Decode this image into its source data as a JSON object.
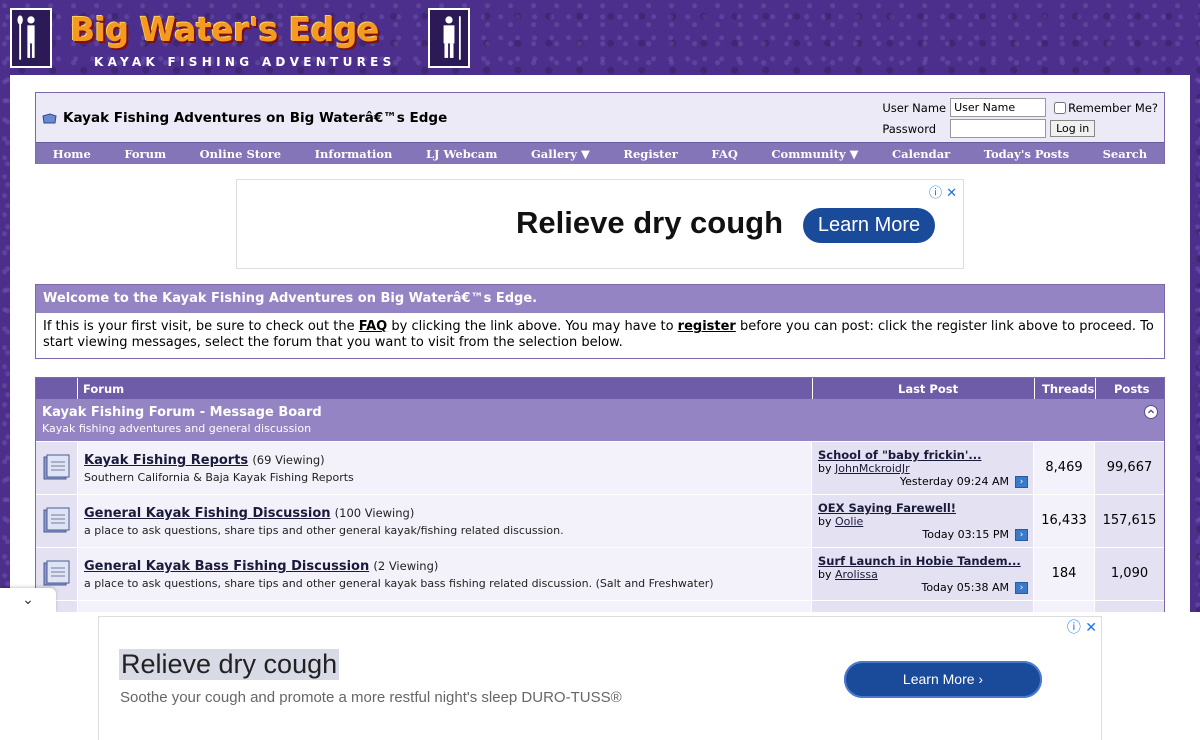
{
  "header": {
    "title": "Big Water's Edge",
    "subtitle": "KAYAK FISHING ADVENTURES"
  },
  "navbar": {
    "breadcrumb": "Kayak Fishing Adventures on Big Waterâ€™s Edge",
    "login": {
      "username_label": "User Name",
      "username_value": "User Name",
      "remember_label": "Remember Me?",
      "password_label": "Password",
      "login_button": "Log in"
    },
    "menu": [
      "Home",
      "Forum",
      "Online Store",
      "Information",
      "LJ Webcam",
      "Gallery ▼",
      "Register",
      "FAQ",
      "Community ▼",
      "Calendar",
      "Today's Posts",
      "Search"
    ]
  },
  "ad_top": {
    "text": "Relieve dry cough",
    "button": "Learn More",
    "close": "ⓘ ✕"
  },
  "notice": {
    "title": "Welcome to the Kayak Fishing Adventures on Big Waterâ€™s Edge.",
    "body_1": "If this is your first visit, be sure to check out the ",
    "faq_link": "FAQ",
    "body_2": " by clicking the link above. You may have to ",
    "register_link": "register",
    "body_3": " before you can post: click the register link above to proceed. To start viewing messages, select the forum that you want to visit from the selection below."
  },
  "forum_table": {
    "headers": {
      "forum": "Forum",
      "last_post": "Last Post",
      "threads": "Threads",
      "posts": "Posts"
    },
    "category": {
      "title": "Kayak Fishing Forum - Message Board",
      "description": "Kayak fishing adventures and general discussion"
    },
    "rows": [
      {
        "name": "Kayak Fishing Reports",
        "viewing": "(69 Viewing)",
        "description": "Southern California & Baja Kayak Fishing Reports",
        "last_title": "School of \"baby frickin'...",
        "last_by": "by ",
        "last_user": "JohnMckroidJr",
        "last_date": "Yesterday 09:24 AM",
        "threads": "8,469",
        "posts": "99,667"
      },
      {
        "name": "General Kayak Fishing Discussion",
        "viewing": "(100 Viewing)",
        "description": "a place to ask questions, share tips and other general kayak/fishing related discussion.",
        "last_title": "OEX Saying Farewell!",
        "last_by": "by ",
        "last_user": "Oolie",
        "last_date": "Today 03:15 PM",
        "threads": "16,433",
        "posts": "157,615"
      },
      {
        "name": "General Kayak Bass Fishing Discussion",
        "viewing": "(2 Viewing)",
        "description": "a place to ask questions, share tips and other general kayak bass fishing related discussion. (Salt and Freshwater)",
        "last_title": "Surf Launch in Hobie Tandem...",
        "last_by": "by ",
        "last_user": "Arolissa",
        "last_date": "Today 05:38 AM",
        "threads": "184",
        "posts": "1,090"
      }
    ]
  },
  "ad_bottom": {
    "title": "Relieve dry cough",
    "description": "Soothe your cough and promote a more restful night's sleep DURO-TUSS®",
    "button": "Learn More  ›",
    "close": "ⓘ ✕",
    "collapse": "⌄"
  }
}
